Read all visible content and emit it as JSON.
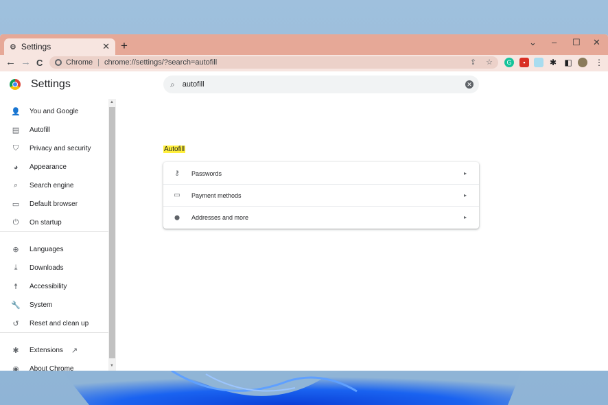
{
  "window": {
    "tab_title": "Settings",
    "tab_close": "✕",
    "new_tab": "+",
    "controls": {
      "minimize": "–",
      "maximize": "☐",
      "close": "✕",
      "dropdown": "⌄"
    }
  },
  "toolbar": {
    "back": "←",
    "forward": "→",
    "reload": "C",
    "site_label": "Chrome",
    "url": "chrome://settings/?search=autofill",
    "share": "⇪",
    "bookmark": "☆"
  },
  "header": {
    "title": "Settings"
  },
  "search": {
    "value": "autofill",
    "clear": "✕"
  },
  "sidebar": {
    "items": [
      {
        "label": "You and Google",
        "icon": "person-icon",
        "glyph": "👤"
      },
      {
        "label": "Autofill",
        "icon": "clipboard-icon",
        "glyph": "▤"
      },
      {
        "label": "Privacy and security",
        "icon": "shield-icon",
        "glyph": "⛉"
      },
      {
        "label": "Appearance",
        "icon": "palette-icon",
        "glyph": "◕"
      },
      {
        "label": "Search engine",
        "icon": "search-icon",
        "glyph": "⌕"
      },
      {
        "label": "Default browser",
        "icon": "browser-icon",
        "glyph": "▭"
      },
      {
        "label": "On startup",
        "icon": "power-icon",
        "glyph": "⏻"
      },
      {
        "label": "Languages",
        "icon": "globe-icon",
        "glyph": "⊕"
      },
      {
        "label": "Downloads",
        "icon": "download-icon",
        "glyph": "⤓"
      },
      {
        "label": "Accessibility",
        "icon": "accessibility-icon",
        "glyph": "☨"
      },
      {
        "label": "System",
        "icon": "wrench-icon",
        "glyph": "🔧"
      },
      {
        "label": "Reset and clean up",
        "icon": "history-icon",
        "glyph": "↺"
      },
      {
        "label": "Extensions",
        "icon": "puzzle-icon",
        "glyph": "✱",
        "external": "↗"
      },
      {
        "label": "About Chrome",
        "icon": "chrome-icon",
        "glyph": "◉"
      }
    ]
  },
  "main": {
    "section_label": "Autofill",
    "rows": [
      {
        "label": "Passwords",
        "icon": "key-icon",
        "glyph": "⚷",
        "chevron": "▸"
      },
      {
        "label": "Payment methods",
        "icon": "credit-card-icon",
        "glyph": "▭",
        "chevron": "▸"
      },
      {
        "label": "Addresses and more",
        "icon": "location-pin-icon",
        "glyph": "⬤",
        "chevron": "▸"
      }
    ]
  },
  "colors": {
    "tabstrip": "#e6a897",
    "toolbar": "#f7e5e0",
    "highlight": "#ffef3c"
  }
}
